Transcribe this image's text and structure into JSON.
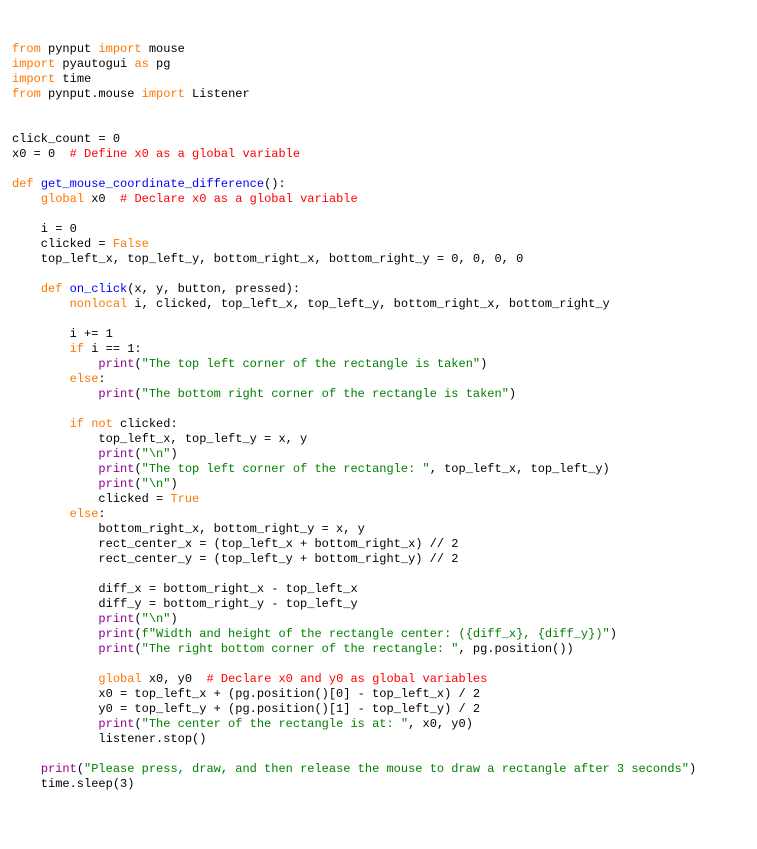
{
  "tokens": [
    {
      "cls": "kw-orange",
      "t": "from"
    },
    {
      "cls": "kw-black",
      "t": " pynput "
    },
    {
      "cls": "kw-orange",
      "t": "import"
    },
    {
      "cls": "kw-black",
      "t": " mouse\n"
    },
    {
      "cls": "kw-orange",
      "t": "import"
    },
    {
      "cls": "kw-black",
      "t": " pyautogui "
    },
    {
      "cls": "kw-orange",
      "t": "as"
    },
    {
      "cls": "kw-black",
      "t": " pg\n"
    },
    {
      "cls": "kw-orange",
      "t": "import"
    },
    {
      "cls": "kw-black",
      "t": " time\n"
    },
    {
      "cls": "kw-orange",
      "t": "from"
    },
    {
      "cls": "kw-black",
      "t": " pynput.mouse "
    },
    {
      "cls": "kw-orange",
      "t": "import"
    },
    {
      "cls": "kw-black",
      "t": " Listener\n\n\n"
    },
    {
      "cls": "kw-black",
      "t": "click_count = 0\n"
    },
    {
      "cls": "kw-black",
      "t": "x0 = 0  "
    },
    {
      "cls": "kw-red",
      "t": "# Define x0 as a global variable"
    },
    {
      "cls": "kw-black",
      "t": "\n\n"
    },
    {
      "cls": "kw-orange",
      "t": "def"
    },
    {
      "cls": "kw-black",
      "t": " "
    },
    {
      "cls": "kw-blue",
      "t": "get_mouse_coordinate_difference"
    },
    {
      "cls": "kw-black",
      "t": "():\n"
    },
    {
      "cls": "kw-black",
      "t": "    "
    },
    {
      "cls": "kw-orange",
      "t": "global"
    },
    {
      "cls": "kw-black",
      "t": " x0  "
    },
    {
      "cls": "kw-red",
      "t": "# Declare x0 as a global variable"
    },
    {
      "cls": "kw-black",
      "t": "\n\n"
    },
    {
      "cls": "kw-black",
      "t": "    i = 0\n"
    },
    {
      "cls": "kw-black",
      "t": "    clicked = "
    },
    {
      "cls": "kw-orange",
      "t": "False"
    },
    {
      "cls": "kw-black",
      "t": "\n"
    },
    {
      "cls": "kw-black",
      "t": "    top_left_x, top_left_y, bottom_right_x, bottom_right_y = 0, 0, 0, 0\n\n"
    },
    {
      "cls": "kw-black",
      "t": "    "
    },
    {
      "cls": "kw-orange",
      "t": "def"
    },
    {
      "cls": "kw-black",
      "t": " "
    },
    {
      "cls": "kw-blue",
      "t": "on_click"
    },
    {
      "cls": "kw-black",
      "t": "(x, y, button, pressed):\n"
    },
    {
      "cls": "kw-black",
      "t": "        "
    },
    {
      "cls": "kw-orange",
      "t": "nonlocal"
    },
    {
      "cls": "kw-black",
      "t": " i, clicked, top_left_x, top_left_y, bottom_right_x, bottom_right_y\n\n"
    },
    {
      "cls": "kw-black",
      "t": "        i += 1\n"
    },
    {
      "cls": "kw-black",
      "t": "        "
    },
    {
      "cls": "kw-orange",
      "t": "if"
    },
    {
      "cls": "kw-black",
      "t": " i == 1:\n"
    },
    {
      "cls": "kw-black",
      "t": "            "
    },
    {
      "cls": "kw-purple",
      "t": "print"
    },
    {
      "cls": "kw-black",
      "t": "("
    },
    {
      "cls": "kw-green",
      "t": "\"The top left corner of the rectangle is taken\""
    },
    {
      "cls": "kw-black",
      "t": ")\n"
    },
    {
      "cls": "kw-black",
      "t": "        "
    },
    {
      "cls": "kw-orange",
      "t": "else"
    },
    {
      "cls": "kw-black",
      "t": ":\n"
    },
    {
      "cls": "kw-black",
      "t": "            "
    },
    {
      "cls": "kw-purple",
      "t": "print"
    },
    {
      "cls": "kw-black",
      "t": "("
    },
    {
      "cls": "kw-green",
      "t": "\"The bottom right corner of the rectangle is taken\""
    },
    {
      "cls": "kw-black",
      "t": ")\n\n"
    },
    {
      "cls": "kw-black",
      "t": "        "
    },
    {
      "cls": "kw-orange",
      "t": "if"
    },
    {
      "cls": "kw-black",
      "t": " "
    },
    {
      "cls": "kw-orange",
      "t": "not"
    },
    {
      "cls": "kw-black",
      "t": " clicked:\n"
    },
    {
      "cls": "kw-black",
      "t": "            top_left_x, top_left_y = x, y\n"
    },
    {
      "cls": "kw-black",
      "t": "            "
    },
    {
      "cls": "kw-purple",
      "t": "print"
    },
    {
      "cls": "kw-black",
      "t": "("
    },
    {
      "cls": "kw-green",
      "t": "\"\\n\""
    },
    {
      "cls": "kw-black",
      "t": ")\n"
    },
    {
      "cls": "kw-black",
      "t": "            "
    },
    {
      "cls": "kw-purple",
      "t": "print"
    },
    {
      "cls": "kw-black",
      "t": "("
    },
    {
      "cls": "kw-green",
      "t": "\"The top left corner of the rectangle: \""
    },
    {
      "cls": "kw-black",
      "t": ", top_left_x, top_left_y)\n"
    },
    {
      "cls": "kw-black",
      "t": "            "
    },
    {
      "cls": "kw-purple",
      "t": "print"
    },
    {
      "cls": "kw-black",
      "t": "("
    },
    {
      "cls": "kw-green",
      "t": "\"\\n\""
    },
    {
      "cls": "kw-black",
      "t": ")\n"
    },
    {
      "cls": "kw-black",
      "t": "            clicked = "
    },
    {
      "cls": "kw-orange",
      "t": "True"
    },
    {
      "cls": "kw-black",
      "t": "\n"
    },
    {
      "cls": "kw-black",
      "t": "        "
    },
    {
      "cls": "kw-orange",
      "t": "else"
    },
    {
      "cls": "kw-black",
      "t": ":\n"
    },
    {
      "cls": "kw-black",
      "t": "            bottom_right_x, bottom_right_y = x, y\n"
    },
    {
      "cls": "kw-black",
      "t": "            rect_center_x = (top_left_x + bottom_right_x) // 2\n"
    },
    {
      "cls": "kw-black",
      "t": "            rect_center_y = (top_left_y + bottom_right_y) // 2\n\n"
    },
    {
      "cls": "kw-black",
      "t": "            diff_x = bottom_right_x - top_left_x\n"
    },
    {
      "cls": "kw-black",
      "t": "            diff_y = bottom_right_y - top_left_y\n"
    },
    {
      "cls": "kw-black",
      "t": "            "
    },
    {
      "cls": "kw-purple",
      "t": "print"
    },
    {
      "cls": "kw-black",
      "t": "("
    },
    {
      "cls": "kw-green",
      "t": "\"\\n\""
    },
    {
      "cls": "kw-black",
      "t": ")\n"
    },
    {
      "cls": "kw-black",
      "t": "            "
    },
    {
      "cls": "kw-purple",
      "t": "print"
    },
    {
      "cls": "kw-black",
      "t": "("
    },
    {
      "cls": "kw-green",
      "t": "f\"Width and height of the rectangle center: ({diff_x}, {diff_y})\""
    },
    {
      "cls": "kw-black",
      "t": ")\n"
    },
    {
      "cls": "kw-black",
      "t": "            "
    },
    {
      "cls": "kw-purple",
      "t": "print"
    },
    {
      "cls": "kw-black",
      "t": "("
    },
    {
      "cls": "kw-green",
      "t": "\"The right bottom corner of the rectangle: \""
    },
    {
      "cls": "kw-black",
      "t": ", pg.position())\n\n"
    },
    {
      "cls": "kw-black",
      "t": "            "
    },
    {
      "cls": "kw-orange",
      "t": "global"
    },
    {
      "cls": "kw-black",
      "t": " x0, y0  "
    },
    {
      "cls": "kw-red",
      "t": "# Declare x0 and y0 as global variables"
    },
    {
      "cls": "kw-black",
      "t": "\n"
    },
    {
      "cls": "kw-black",
      "t": "            x0 = top_left_x + (pg.position()[0] - top_left_x) / 2\n"
    },
    {
      "cls": "kw-black",
      "t": "            y0 = top_left_y + (pg.position()[1] - top_left_y) / 2\n"
    },
    {
      "cls": "kw-black",
      "t": "            "
    },
    {
      "cls": "kw-purple",
      "t": "print"
    },
    {
      "cls": "kw-black",
      "t": "("
    },
    {
      "cls": "kw-green",
      "t": "\"The center of the rectangle is at: \""
    },
    {
      "cls": "kw-black",
      "t": ", x0, y0)\n"
    },
    {
      "cls": "kw-black",
      "t": "            listener.stop()\n\n"
    },
    {
      "cls": "kw-black",
      "t": "    "
    },
    {
      "cls": "kw-purple",
      "t": "print"
    },
    {
      "cls": "kw-black",
      "t": "("
    },
    {
      "cls": "kw-green",
      "t": "\"Please press, draw, and then release the mouse to draw a rectangle after 3 seconds\""
    },
    {
      "cls": "kw-black",
      "t": ")\n"
    },
    {
      "cls": "kw-black",
      "t": "    time.sleep(3)"
    }
  ]
}
